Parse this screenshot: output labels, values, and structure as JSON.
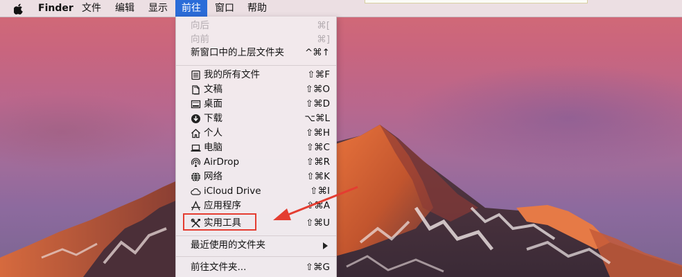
{
  "menubar": {
    "app_name": "Finder",
    "items": [
      {
        "label": "文件"
      },
      {
        "label": "编辑"
      },
      {
        "label": "显示"
      },
      {
        "label": "前往"
      },
      {
        "label": "窗口"
      },
      {
        "label": "帮助"
      }
    ],
    "active_menu": "前往",
    "apple_icon": "apple-logo-icon"
  },
  "go_menu": {
    "back": {
      "label": "向后",
      "shortcut": "⌘[",
      "enabled": false
    },
    "forward": {
      "label": "向前",
      "shortcut": "⌘]",
      "enabled": false
    },
    "enclosing": {
      "label": "新窗口中的上层文件夹",
      "shortcut": "^⌘↑"
    },
    "places": [
      {
        "label": "我的所有文件",
        "shortcut": "⇧⌘F",
        "icon": "all-files-icon"
      },
      {
        "label": "文稿",
        "shortcut": "⇧⌘O",
        "icon": "documents-icon"
      },
      {
        "label": "桌面",
        "shortcut": "⇧⌘D",
        "icon": "desktop-icon"
      },
      {
        "label": "下载",
        "shortcut": "⌥⌘L",
        "icon": "downloads-icon"
      },
      {
        "label": "个人",
        "shortcut": "⇧⌘H",
        "icon": "home-icon"
      },
      {
        "label": "电脑",
        "shortcut": "⇧⌘C",
        "icon": "computer-icon"
      },
      {
        "label": "AirDrop",
        "shortcut": "⇧⌘R",
        "icon": "airdrop-icon"
      },
      {
        "label": "网络",
        "shortcut": "⇧⌘K",
        "icon": "network-icon"
      },
      {
        "label": "iCloud Drive",
        "shortcut": "⇧⌘I",
        "icon": "icloud-icon"
      },
      {
        "label": "应用程序",
        "shortcut": "⇧⌘A",
        "icon": "applications-icon"
      },
      {
        "label": "实用工具",
        "shortcut": "⇧⌘U",
        "icon": "utilities-icon"
      }
    ],
    "recent_folders": {
      "label": "最近使用的文件夹",
      "has_submenu": true
    },
    "go_to_folder": {
      "label": "前往文件夹...",
      "shortcut": "⇧⌘G"
    }
  },
  "annotation": {
    "highlighted_item": "实用工具",
    "color": "#e43d31"
  },
  "colors": {
    "menubar_active": "#2a6cd8",
    "disabled_text": "#b3abb0"
  }
}
